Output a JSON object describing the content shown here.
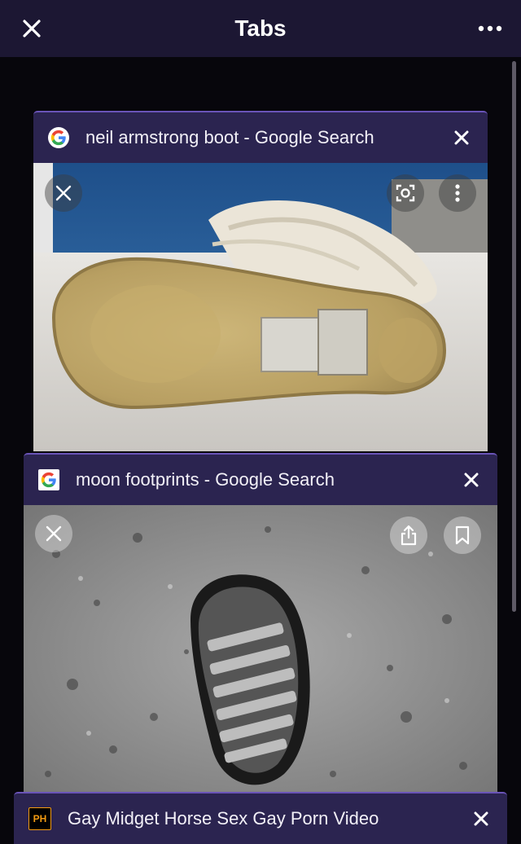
{
  "header": {
    "title": "Tabs"
  },
  "tabs": [
    {
      "title": "neil armstrong boot - Google Search",
      "favicon": "google-g-icon"
    },
    {
      "title": "moon footprints - Google Search",
      "favicon": "google-g-icon"
    },
    {
      "title": "Gay Midget Horse Sex Gay Porn Video",
      "favicon_text": "PH"
    }
  ],
  "colors": {
    "header_bg": "#1c1733",
    "tab_header_bg": "#2b2450",
    "accent": "#6a54b8"
  }
}
